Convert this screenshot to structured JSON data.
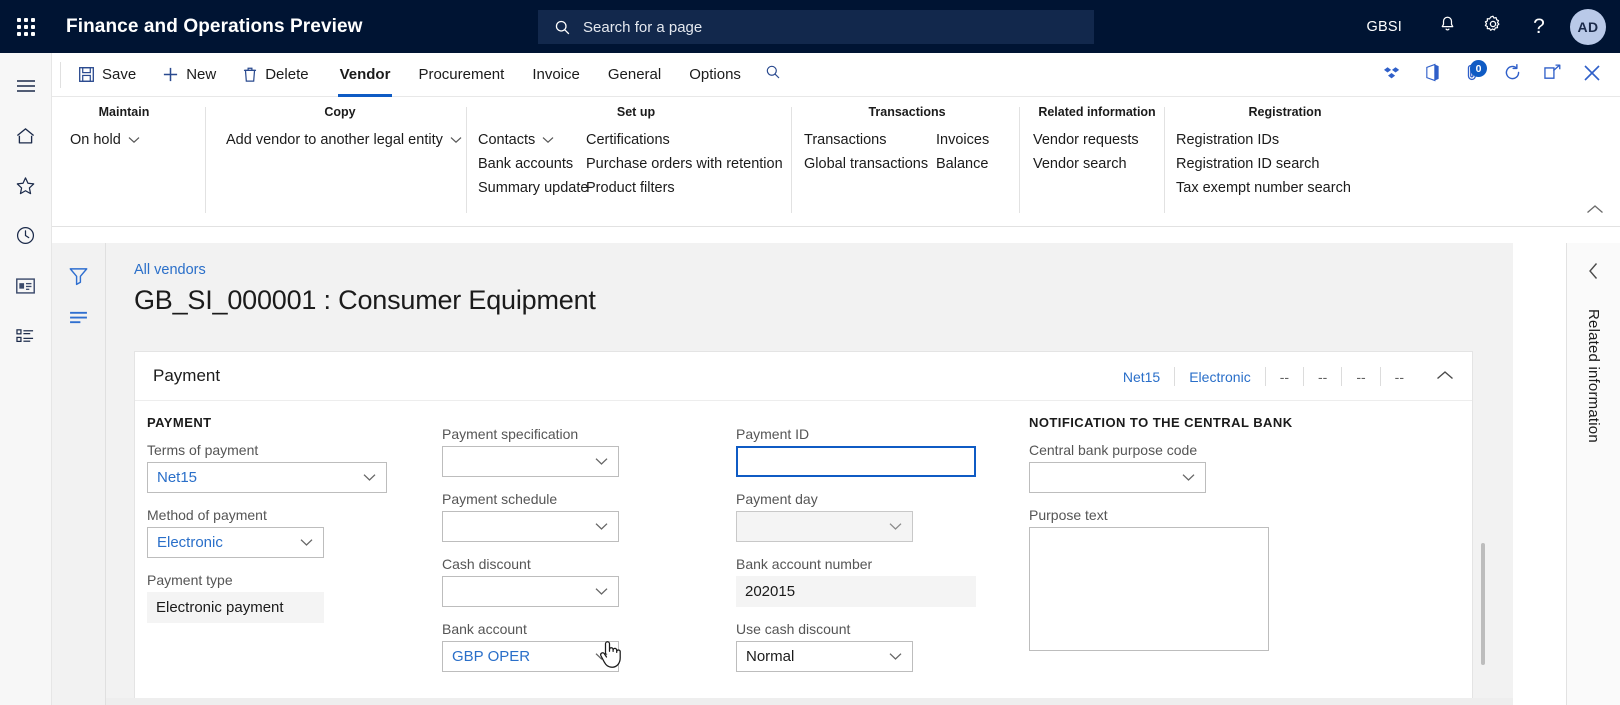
{
  "topbar": {
    "app_title": "Finance and Operations Preview",
    "waffle_icon": "app-launcher-icon",
    "search": {
      "placeholder": "Search for a page",
      "icon": "search-icon"
    },
    "company_code": "GBSI",
    "notifications_icon": "bell-icon",
    "settings_icon": "gear-icon",
    "help_icon": "question-mark-icon",
    "avatar_initials": "AD"
  },
  "leftrail": {
    "items": [
      {
        "name": "hamburger-menu",
        "icon": "hamburger-icon"
      },
      {
        "name": "home",
        "icon": "home-icon"
      },
      {
        "name": "favorites",
        "icon": "star-icon"
      },
      {
        "name": "recent",
        "icon": "clock-icon"
      },
      {
        "name": "workspaces",
        "icon": "workspace-icon"
      },
      {
        "name": "modules",
        "icon": "list-icon"
      }
    ]
  },
  "commandbar": {
    "save_label": "Save",
    "new_label": "New",
    "delete_label": "Delete",
    "save_icon": "save-disk-icon",
    "new_icon": "plus-icon",
    "delete_icon": "trash-icon",
    "search_icon": "search-icon",
    "tabs": [
      {
        "label": "Vendor",
        "active": true
      },
      {
        "label": "Procurement",
        "active": false
      },
      {
        "label": "Invoice",
        "active": false
      },
      {
        "label": "General",
        "active": false
      },
      {
        "label": "Options",
        "active": false
      }
    ],
    "right_icons": [
      {
        "name": "power-apps-icon"
      },
      {
        "name": "office-app-icon"
      },
      {
        "name": "attachments-icon",
        "badge": "0"
      },
      {
        "name": "refresh-icon"
      },
      {
        "name": "open-in-new-window-icon"
      },
      {
        "name": "close-icon"
      }
    ]
  },
  "ribbon": {
    "groups": [
      {
        "title": "Maintain",
        "columns": [
          {
            "items": [
              {
                "label": "On hold",
                "caret": true
              }
            ]
          }
        ]
      },
      {
        "title": "Copy",
        "columns": [
          {
            "items": [
              {
                "label": "Add vendor to another legal entity",
                "caret": true
              }
            ]
          }
        ]
      },
      {
        "title": "Set up",
        "columns": [
          {
            "items": [
              {
                "label": "Contacts",
                "caret": true
              },
              {
                "label": "Bank accounts",
                "caret": false
              },
              {
                "label": "Summary update",
                "caret": false
              }
            ]
          },
          {
            "items": [
              {
                "label": "Certifications",
                "caret": false
              },
              {
                "label": "Purchase orders with retention",
                "caret": false
              },
              {
                "label": "Product filters",
                "caret": false
              }
            ]
          }
        ]
      },
      {
        "title": "Transactions",
        "columns": [
          {
            "items": [
              {
                "label": "Transactions",
                "caret": false
              },
              {
                "label": "Global transactions",
                "caret": false
              }
            ]
          },
          {
            "items": [
              {
                "label": "Invoices",
                "caret": false
              },
              {
                "label": "Balance",
                "caret": false
              }
            ]
          }
        ]
      },
      {
        "title": "Related information",
        "columns": [
          {
            "items": [
              {
                "label": "Vendor requests",
                "caret": false
              },
              {
                "label": "Vendor search",
                "caret": false
              }
            ]
          }
        ]
      },
      {
        "title": "Registration",
        "columns": [
          {
            "items": [
              {
                "label": "Registration IDs",
                "caret": false
              },
              {
                "label": "Registration ID search",
                "caret": false
              },
              {
                "label": "Tax exempt number search",
                "caret": false
              }
            ]
          }
        ]
      }
    ],
    "collapse_icon": "chevron-up-icon"
  },
  "filterrail": {
    "filter_icon": "filter-funnel-icon",
    "list_icon": "list-lines-icon"
  },
  "page": {
    "breadcrumb": "All vendors",
    "title": "GB_SI_000001 : Consumer Equipment"
  },
  "payment_card": {
    "title": "Payment",
    "summary": [
      "Net15",
      "Electronic",
      "--",
      "--",
      "--",
      "--"
    ],
    "collapse_icon": "chevron-up-icon",
    "columns": {
      "col1": {
        "group_header": "PAYMENT",
        "fields": [
          {
            "label": "Terms of payment",
            "value": "Net15",
            "type": "combobox",
            "link": true
          },
          {
            "label": "Method of payment",
            "value": "Electronic",
            "type": "combobox",
            "link": true
          },
          {
            "label": "Payment type",
            "value": "Electronic payment",
            "type": "static"
          }
        ]
      },
      "col2": {
        "fields": [
          {
            "label": "Payment specification",
            "value": "",
            "type": "combobox"
          },
          {
            "label": "Payment schedule",
            "value": "",
            "type": "combobox"
          },
          {
            "label": "Cash discount",
            "value": "",
            "type": "combobox"
          },
          {
            "label": "Bank account",
            "value": "GBP OPER",
            "type": "combobox",
            "link": true
          }
        ]
      },
      "col3": {
        "fields": [
          {
            "label": "Payment ID",
            "value": "",
            "type": "text",
            "focused": true
          },
          {
            "label": "Payment day",
            "value": "",
            "type": "combobox",
            "disabled": true
          },
          {
            "label": "Bank account number",
            "value": "202015",
            "type": "static"
          },
          {
            "label": "Use cash discount",
            "value": "Normal",
            "type": "combobox"
          }
        ]
      },
      "col4": {
        "group_header": "NOTIFICATION TO THE CENTRAL BANK",
        "fields": [
          {
            "label": "Central bank purpose code",
            "value": "",
            "type": "combobox"
          },
          {
            "label": "Purpose text",
            "value": "",
            "type": "textarea"
          }
        ]
      }
    }
  },
  "related_panel": {
    "chevron_icon": "chevron-left-icon",
    "label": "Related information"
  },
  "colors": {
    "nav_bg": "#001433",
    "accent": "#0f5bc4",
    "link": "#2a6fc9",
    "page_bg": "#f2f2f2"
  }
}
